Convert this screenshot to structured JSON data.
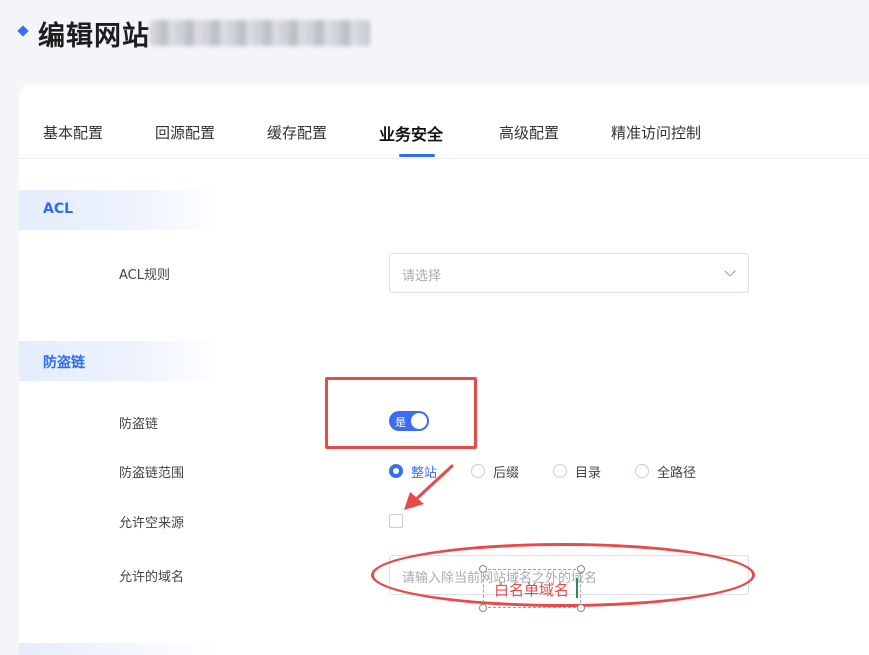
{
  "header": {
    "title": "编辑网站"
  },
  "tabs": [
    {
      "label": "基本配置"
    },
    {
      "label": "回源配置"
    },
    {
      "label": "缓存配置"
    },
    {
      "label": "业务安全"
    },
    {
      "label": "高级配置"
    },
    {
      "label": "精准访问控制"
    }
  ],
  "acl": {
    "section_title": "ACL",
    "rule_label": "ACL规则",
    "rule_placeholder": "请选择"
  },
  "hotlink": {
    "section_title": "防盗链",
    "toggle_label": "防盗链",
    "toggle_value": "是",
    "scope_label": "防盗链范围",
    "scope_options": [
      "整站",
      "后缀",
      "目录",
      "全路径"
    ],
    "scope_selected": "整站",
    "allow_empty_label": "允许空来源",
    "allowed_domains_label": "允许的域名",
    "allowed_domains_placeholder": "请输入除当前网站域名之外的域名"
  },
  "annotation": {
    "text": "白名单域名",
    "color": "#e84a4a"
  },
  "colors": {
    "accent": "#3a6df0",
    "annotation_red": "#e84a4a"
  }
}
